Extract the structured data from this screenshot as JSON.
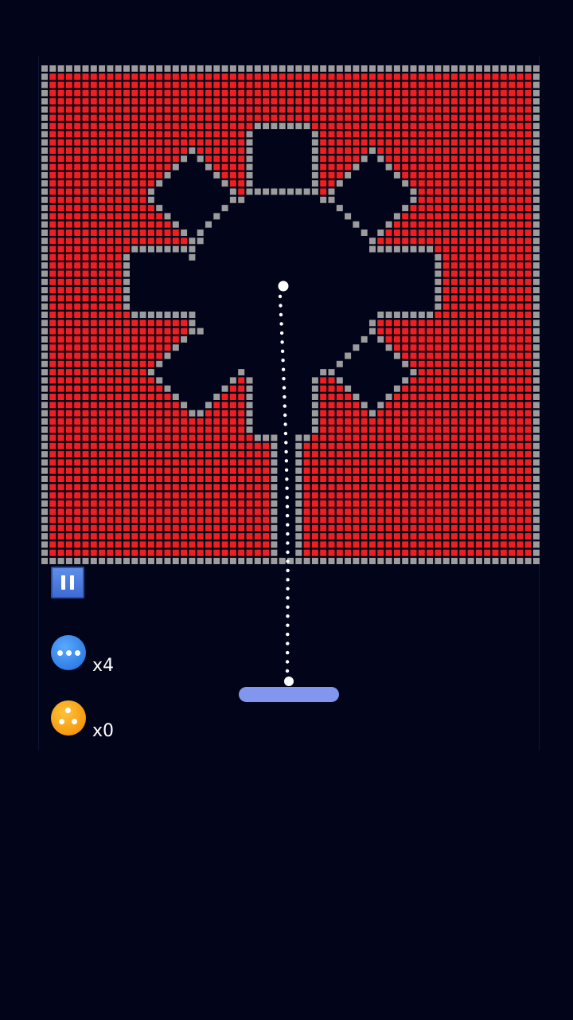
{
  "game": {
    "colors": {
      "background": "#020419",
      "brick_red": "#ee1f21",
      "brick_wall": "#9c9c9c",
      "paddle": "#8096ef",
      "ball": "#ffffff",
      "pause_button": "#4a7ae0",
      "multiball": "#2f7fe6",
      "splitball": "#f59a10"
    },
    "hud": {
      "pause_icon": "pause-icon",
      "multiball_icon": "three-dots-ball-icon",
      "multiball_count": "x4",
      "splitball_icon": "triple-ball-icon",
      "splitball_count": "x0"
    },
    "aim_guide": "dotted-trajectory"
  }
}
